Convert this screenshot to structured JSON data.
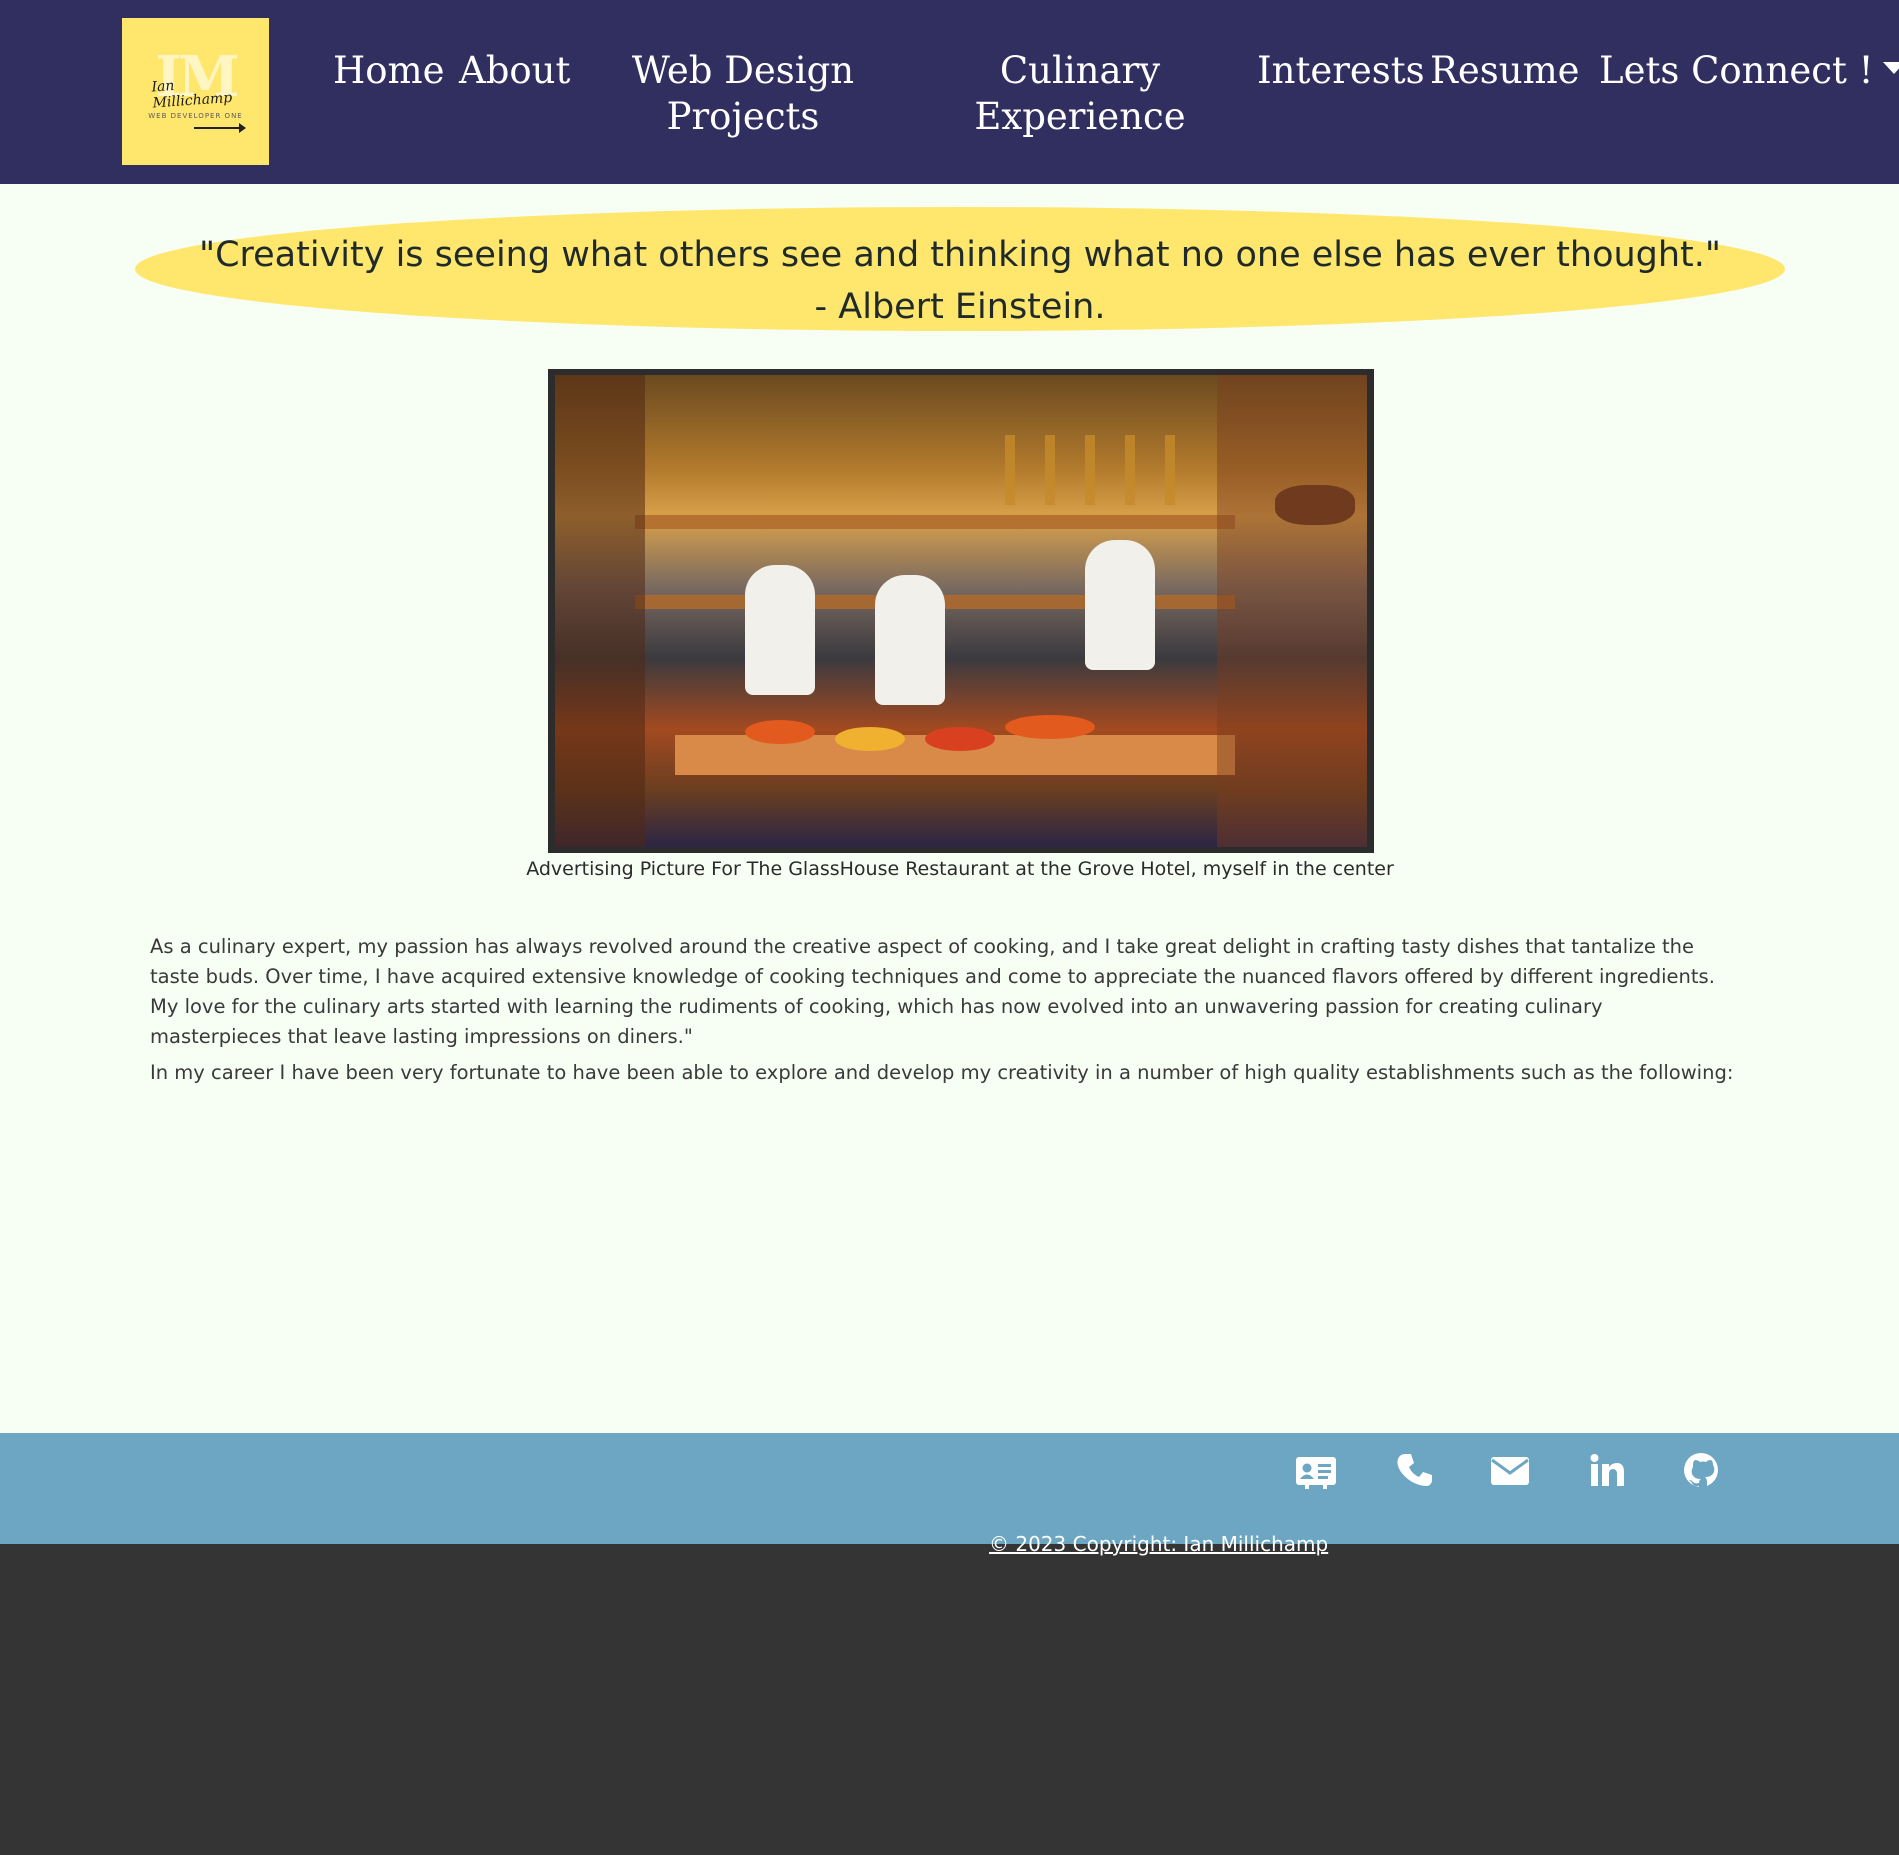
{
  "nav": {
    "logo": {
      "initials": "IM",
      "script": "Ian Millichamp",
      "subtitle": "WEB DEVELOPER ONE"
    },
    "links": {
      "home": "Home",
      "about": "About",
      "web_design_projects": "Web Design Projects",
      "culinary_experience": "Culinary Experience",
      "interests": "Interests",
      "resume": "Resume",
      "lets_connect": "Lets Connect !"
    }
  },
  "main": {
    "quote": {
      "text": "\"Creativity is seeing what others see and thinking what no one else has ever thought.\"",
      "author": "- Albert Einstein."
    },
    "image_caption": "Advertising Picture For The GlassHouse Restaurant at the Grove Hotel, myself in the center",
    "paragraphs": [
      "As a culinary expert, my passion has always revolved around the creative aspect of cooking, and I take great delight in crafting tasty dishes that tantalize the taste buds. Over time, I have acquired extensive knowledge of cooking techniques and come to appreciate the nuanced flavors offered by different ingredients. My love for the culinary arts started with learning the rudiments of cooking, which has now evolved into an unwavering passion for creating culinary masterpieces that leave lasting impressions on diners.\"",
      "In my career I have been very fortunate to have been able to explore and develop my creativity in a number of high quality establishments such as the following:"
    ]
  },
  "footer": {
    "social_icons": [
      "contact-card-icon",
      "phone-icon",
      "envelope-icon",
      "linkedin-icon",
      "github-icon"
    ],
    "copyright": "© 2023 Copyright: Ian Millichamp"
  },
  "colors": {
    "navbar": "#312e60",
    "accent_yellow": "#ffe66d",
    "main_bg": "#f7fef3",
    "footer_band": "#6ca6c2",
    "footer_bg": "#343434"
  }
}
